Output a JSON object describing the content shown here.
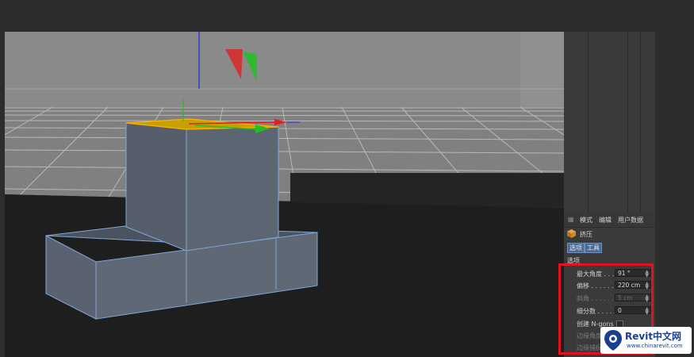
{
  "attributes_panel": {
    "menu": [
      "模式",
      "编辑",
      "用户数据"
    ],
    "object_name": "挤压",
    "tabs": [
      "选项",
      "工具"
    ],
    "section_title": "选项",
    "properties": [
      {
        "label": "最大角度 . . . .",
        "value": "91 °",
        "enabled": true
      },
      {
        "label": "偏移 . . . . . . .",
        "value": "220 cm",
        "enabled": true
      },
      {
        "label": "斜角 . . . . . . .",
        "value": "5 cm",
        "enabled": false
      },
      {
        "label": "细分数 . . . . . .",
        "value": "0",
        "enabled": true
      }
    ],
    "create_ngons_label": "创建 N-gons",
    "extra_labels": [
      "边缘角度",
      "边缘捕捉"
    ]
  },
  "watermark": {
    "brand": "Revit中文网",
    "url": "www.chinarevit.com"
  },
  "colors": {
    "highlight_box": "#e0141e",
    "selected_face": "#c8a000",
    "axis_x": "#e02020",
    "axis_y": "#20c020",
    "axis_z": "#3040d0",
    "active_tab": "#4a6a93",
    "brand": "#1a3f8e"
  }
}
